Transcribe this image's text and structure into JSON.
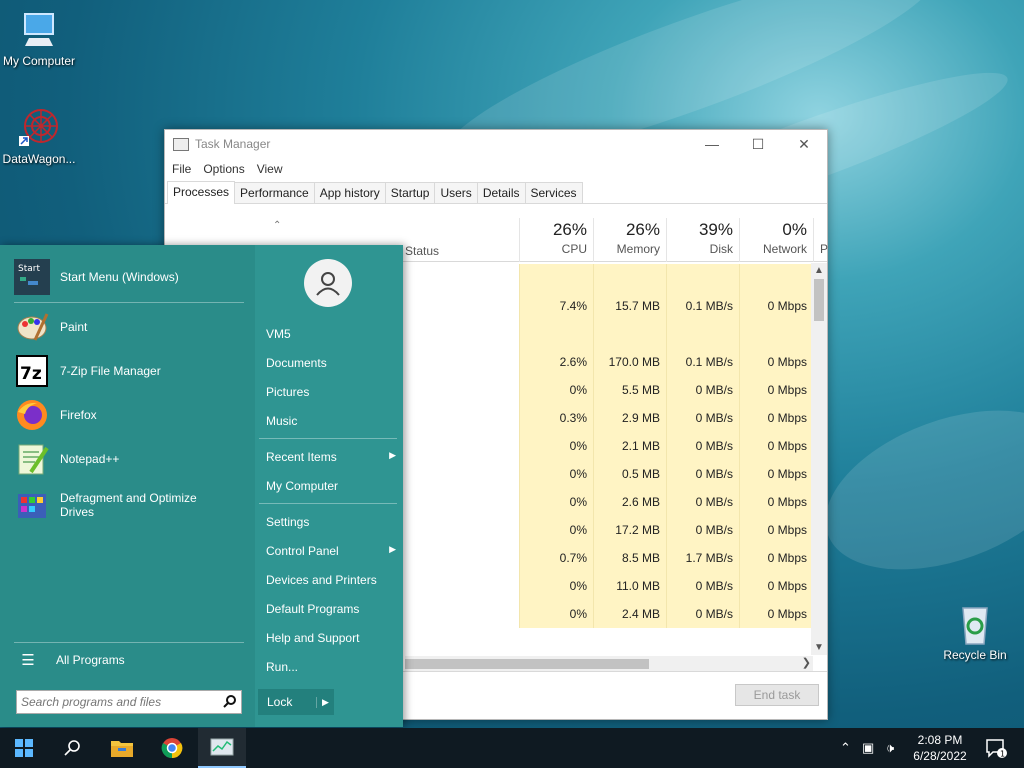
{
  "desktop": {
    "icons": [
      {
        "label": "My Computer"
      },
      {
        "label": "DataWagon..."
      },
      {
        "label": "Recycle Bin"
      }
    ]
  },
  "task_manager": {
    "title": "Task Manager",
    "menu": [
      "File",
      "Options",
      "View"
    ],
    "tabs": [
      "Processes",
      "Performance",
      "App history",
      "Startup",
      "Users",
      "Details",
      "Services"
    ],
    "active_tab": "Processes",
    "columns": {
      "status": "Status",
      "cpu": {
        "pct": "26%",
        "label": "CPU"
      },
      "memory": {
        "pct": "26%",
        "label": "Memory"
      },
      "disk": {
        "pct": "39%",
        "label": "Disk"
      },
      "network": {
        "pct": "0%",
        "label": "Network"
      },
      "power": "P"
    },
    "rows": [
      {
        "cpu": "",
        "mem": "",
        "disk": "",
        "net": ""
      },
      {
        "cpu": "7.4%",
        "mem": "15.7 MB",
        "disk": "0.1 MB/s",
        "net": "0 Mbps"
      },
      {
        "cpu": "",
        "mem": "",
        "disk": "",
        "net": ""
      },
      {
        "cpu": "2.6%",
        "mem": "170.0 MB",
        "disk": "0.1 MB/s",
        "net": "0 Mbps"
      },
      {
        "cpu": "0%",
        "mem": "5.5 MB",
        "disk": "0 MB/s",
        "net": "0 Mbps"
      },
      {
        "cpu": "0.3%",
        "mem": "2.9 MB",
        "disk": "0 MB/s",
        "net": "0 Mbps"
      },
      {
        "cpu": "0%",
        "mem": "2.1 MB",
        "disk": "0 MB/s",
        "net": "0 Mbps"
      },
      {
        "cpu": "0%",
        "mem": "0.5 MB",
        "disk": "0 MB/s",
        "net": "0 Mbps"
      },
      {
        "cpu": "0%",
        "mem": "2.6 MB",
        "disk": "0 MB/s",
        "net": "0 Mbps"
      },
      {
        "cpu": "0%",
        "mem": "17.2 MB",
        "disk": "0 MB/s",
        "net": "0 Mbps"
      },
      {
        "cpu": "0.7%",
        "mem": "8.5 MB",
        "disk": "1.7 MB/s",
        "net": "0 Mbps"
      },
      {
        "cpu": "0%",
        "mem": "11.0 MB",
        "disk": "0 MB/s",
        "net": "0 Mbps"
      },
      {
        "cpu": "0%",
        "mem": "2.4 MB",
        "disk": "0 MB/s",
        "net": "0 Mbps"
      }
    ],
    "end_task": "End task"
  },
  "start_menu": {
    "programs": [
      {
        "label": "Start Menu (Windows)",
        "icon": "start-menu-app-icon"
      },
      {
        "label": "Paint",
        "icon": "paint-icon"
      },
      {
        "label": "7-Zip File Manager",
        "icon": "7zip-icon"
      },
      {
        "label": "Firefox",
        "icon": "firefox-icon"
      },
      {
        "label": "Notepad++",
        "icon": "notepad-plus-plus-icon"
      },
      {
        "label": "Defragment and Optimize Drives",
        "icon": "defrag-icon"
      }
    ],
    "start_icon_text": "Start",
    "z_icon_text": "7z",
    "all_programs": "All Programs",
    "search_placeholder": "Search programs and files",
    "right": {
      "user": "VM5",
      "documents": "Documents",
      "pictures": "Pictures",
      "music": "Music",
      "recent_items": "Recent Items",
      "my_computer": "My Computer",
      "settings": "Settings",
      "control_panel": "Control Panel",
      "devices_printers": "Devices and Printers",
      "default_programs": "Default Programs",
      "help_support": "Help and Support",
      "run": "Run..."
    },
    "lock": "Lock"
  },
  "taskbar": {
    "time": "2:08 PM",
    "date": "6/28/2022",
    "notification_count": "1"
  }
}
